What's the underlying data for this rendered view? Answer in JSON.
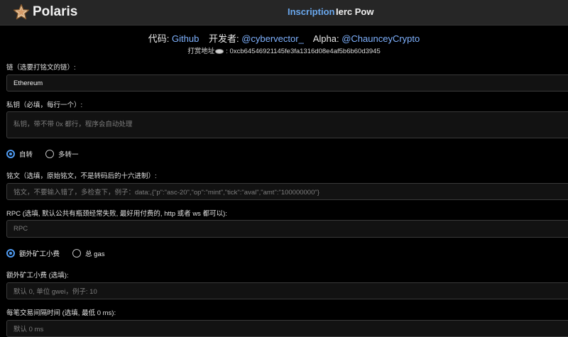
{
  "header": {
    "brand": "Polaris",
    "nav": [
      {
        "label": "Inscription",
        "active": true
      },
      {
        "label": "Ierc Pow",
        "active": false
      }
    ],
    "accent": "#6aa8ee"
  },
  "credits": {
    "code_label": "代码:",
    "code_link": "Github",
    "dev_label": "开发者:",
    "dev_link": "@cybervector_",
    "alpha_label": "Alpha:",
    "alpha_link": "@ChaunceyCrypto"
  },
  "tip": {
    "label": "打赏地址",
    "address": ": 0xcb64546921145fe3fa1316d08e4af5b6b60d3945"
  },
  "form": {
    "chain_label": "链（选要打铭文的链）:",
    "chain_value": "Ethereum",
    "key_label": "私钥（必填，每行一个）:",
    "key_placeholder": "私钥，带不带 0x 都行，程序会自动处理",
    "mode_options": [
      "自转",
      "多转一"
    ],
    "inscription_label": "铭文（选填，原始铭文，不是转码后的十六进制）:",
    "inscription_placeholder": "铭文，不要输入错了，多检查下，例子：data:,{\"p\":\"asc-20\",\"op\":\"mint\",\"tick\":\"aval\",\"amt\":\"100000000\"}",
    "rpc_label": "RPC (选填, 默认公共有瓶颈经常失败, 最好用付费的, http 或者 ws 都可以):",
    "rpc_placeholder": "RPC",
    "gas_options": [
      "额外矿工小费",
      "总 gas"
    ],
    "fee_label": "额外矿工小费 (选填):",
    "fee_placeholder": "默认 0, 单位 gwei，例子: 10",
    "interval_label": "每笔交易间隔时间 (选填, 最低 0 ms):",
    "interval_placeholder": "默认 0 ms"
  },
  "colors": {
    "background": "#000000",
    "header_bg": "#262626",
    "radio_accent": "#4f9bf2"
  }
}
